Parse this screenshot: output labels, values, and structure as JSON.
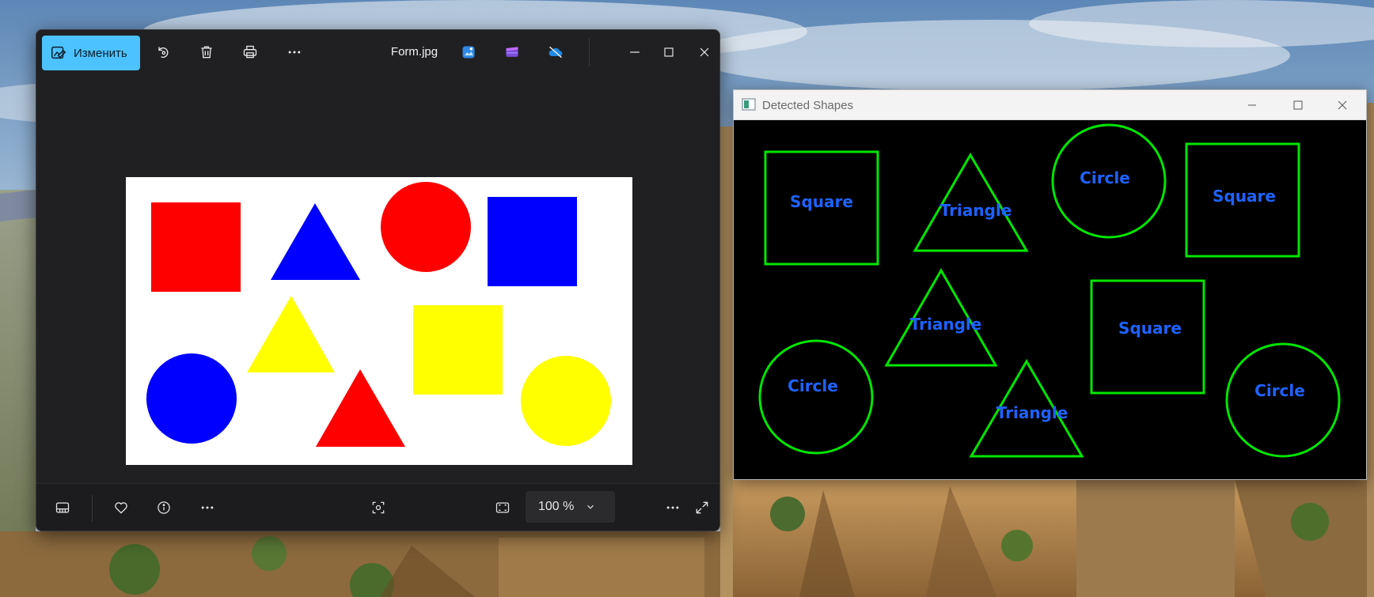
{
  "photos_window": {
    "edit_label": "Изменить",
    "file_name": "Form.jpg",
    "zoom_value": "100 %",
    "toolbar_icons": [
      "edit-image-icon",
      "rotate-icon",
      "trash-icon",
      "print-icon",
      "more-icon",
      "editor-app-icon",
      "clipchamp-icon",
      "onedrive-off-icon"
    ],
    "bottom_icons": [
      "filmstrip-icon",
      "heart-icon",
      "info-icon",
      "more-icon",
      "focus-frame-icon",
      "fit-screen-icon",
      "more-icon",
      "fullscreen-icon"
    ]
  },
  "photo_shapes": [
    {
      "shape": "square",
      "color": "#ff0000"
    },
    {
      "shape": "triangle",
      "color": "#0000ff"
    },
    {
      "shape": "circle",
      "color": "#ff0000"
    },
    {
      "shape": "square",
      "color": "#0000ff"
    },
    {
      "shape": "triangle",
      "color": "#ffff00"
    },
    {
      "shape": "square",
      "color": "#ffff00"
    },
    {
      "shape": "circle",
      "color": "#0000ff"
    },
    {
      "shape": "triangle",
      "color": "#ff0000"
    },
    {
      "shape": "circle",
      "color": "#ffff00"
    }
  ],
  "detected_window": {
    "title": "Detected Shapes",
    "outline_color": "#00e600",
    "label_color": "#1e62ff",
    "labels": [
      "Square",
      "Triangle",
      "Circle",
      "Square",
      "Triangle",
      "Square",
      "Circle",
      "Triangle",
      "Circle"
    ]
  }
}
